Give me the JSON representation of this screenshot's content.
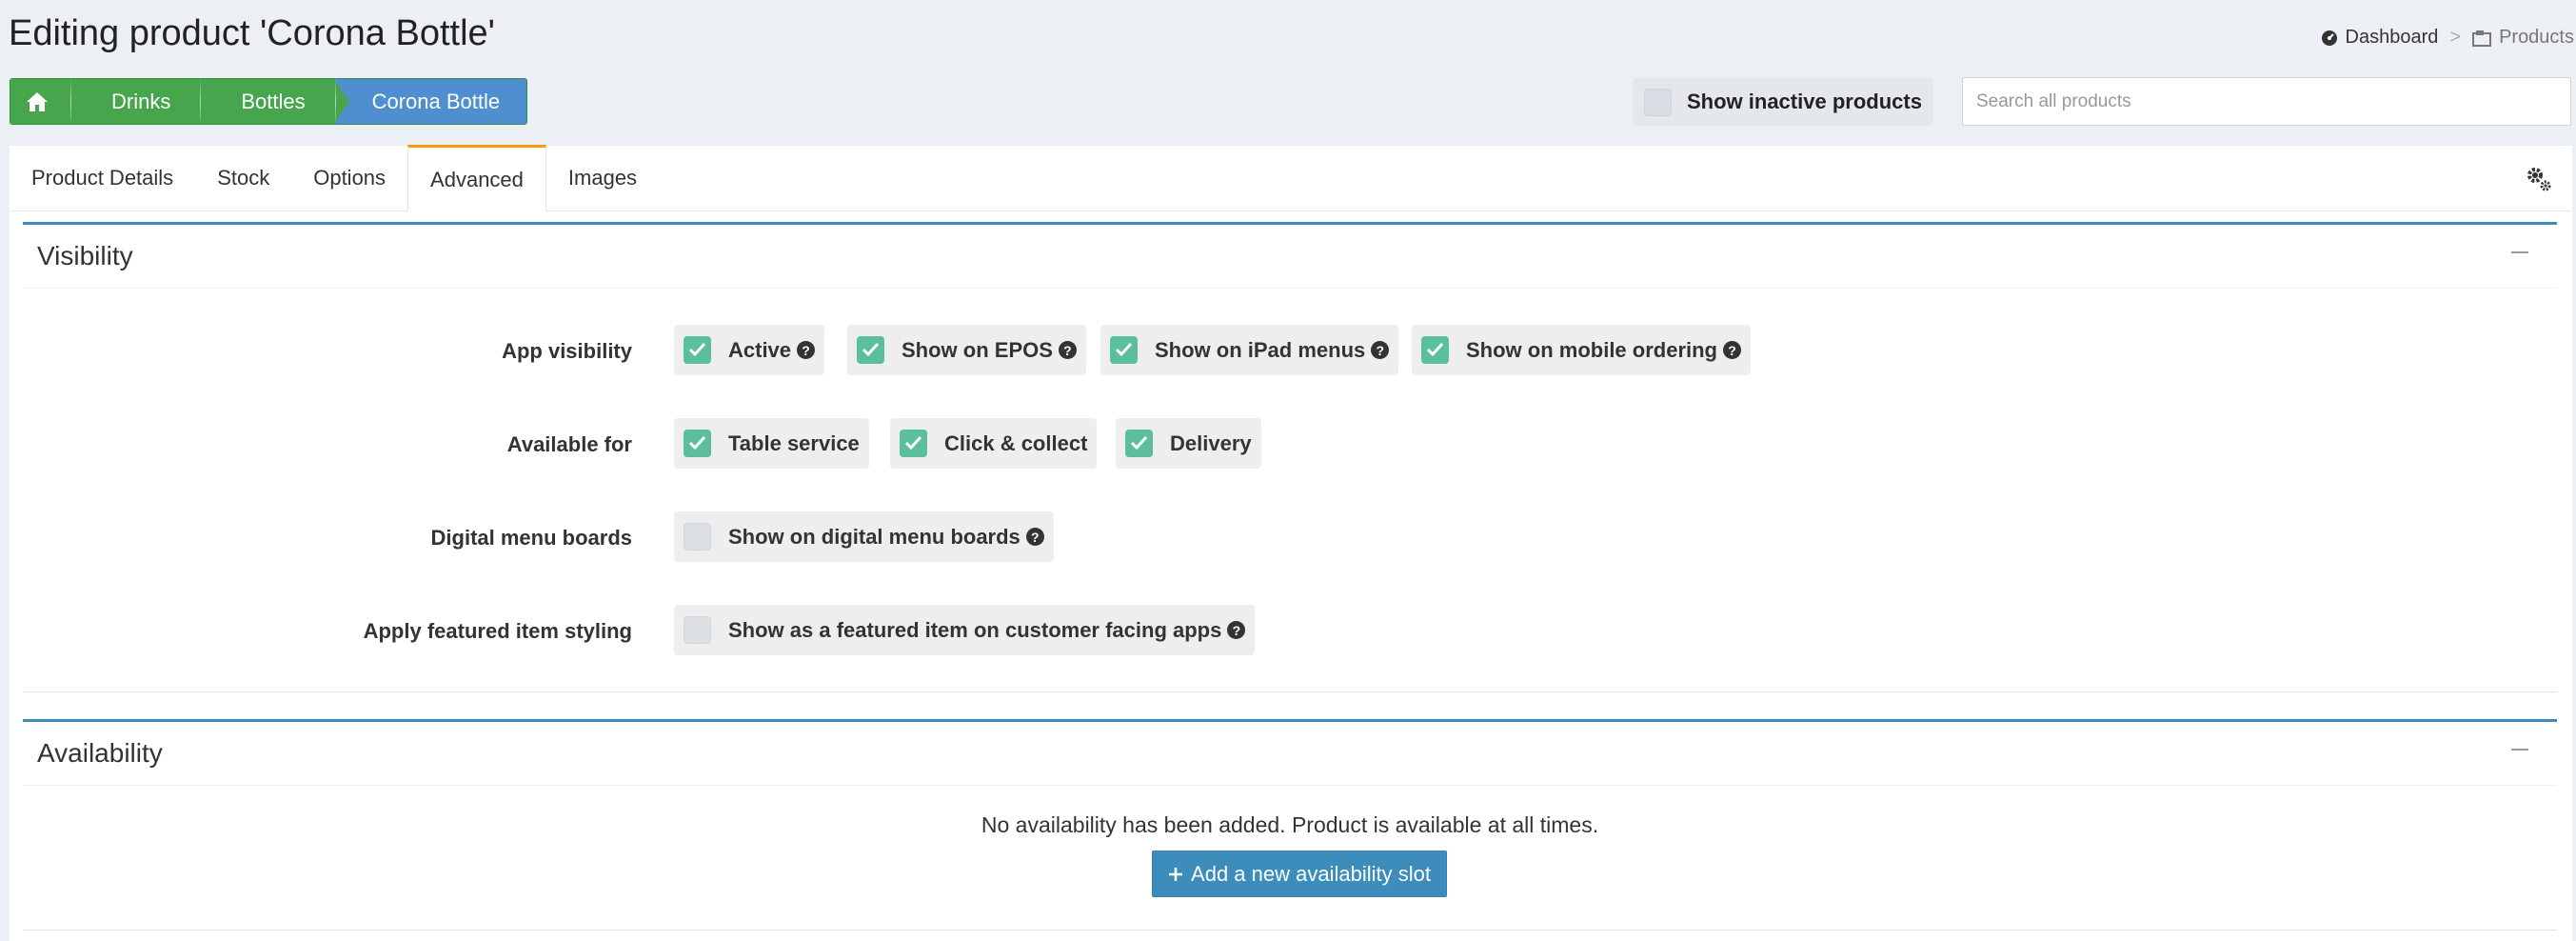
{
  "header": {
    "title": "Editing product 'Corona Bottle'",
    "nav": {
      "dashboard": "Dashboard",
      "separator": ">",
      "products": "Products"
    }
  },
  "breadcrumb": {
    "items": [
      "Drinks",
      "Bottles",
      "Corona Bottle"
    ]
  },
  "toolbar": {
    "inactive_label": "Show inactive products",
    "inactive_checked": false,
    "search_placeholder": "Search all products"
  },
  "tabs": [
    "Product Details",
    "Stock",
    "Options",
    "Advanced",
    "Images"
  ],
  "active_tab": "Advanced",
  "visibility": {
    "title": "Visibility",
    "rows": [
      {
        "label": "App visibility",
        "options": [
          {
            "label": "Active",
            "checked": true,
            "help": true
          },
          {
            "label": "Show on EPOS",
            "checked": true,
            "help": true
          },
          {
            "label": "Show on iPad menus",
            "checked": true,
            "help": true
          },
          {
            "label": "Show on mobile ordering",
            "checked": true,
            "help": true
          }
        ]
      },
      {
        "label": "Available for",
        "options": [
          {
            "label": "Table service",
            "checked": true,
            "help": false
          },
          {
            "label": "Click & collect",
            "checked": true,
            "help": false
          },
          {
            "label": "Delivery",
            "checked": true,
            "help": false
          }
        ]
      },
      {
        "label": "Digital menu boards",
        "options": [
          {
            "label": "Show on digital menu boards",
            "checked": false,
            "help": true
          }
        ]
      },
      {
        "label": "Apply featured item styling",
        "options": [
          {
            "label": "Show as a featured item on customer facing apps",
            "checked": false,
            "help": true
          }
        ]
      }
    ]
  },
  "availability": {
    "title": "Availability",
    "empty_text": "No availability has been added. Product is available at all times.",
    "add_button": "Add a new availability slot"
  },
  "help_glyph": "?",
  "colors": {
    "green": "#47a54d",
    "blue": "#3c8dbc",
    "check": "#5cbf9c",
    "tab_accent": "#f39c12"
  }
}
